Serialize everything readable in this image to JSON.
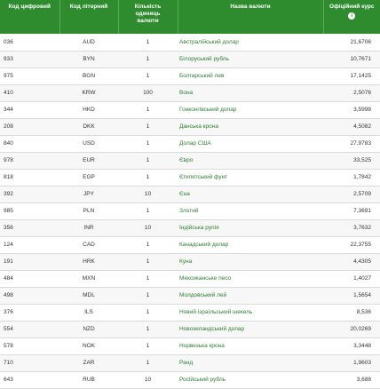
{
  "header": {
    "numeric_code": "Код цифровий",
    "letter_code": "Код літерний",
    "units_line1": "Кількість",
    "units_line2": "одиниць",
    "units_line3": "валюти",
    "name": "Назва валюти",
    "rate": "Офіційний курс",
    "info_icon": "i"
  },
  "colors": {
    "header_bg": "#2e8b2e",
    "name_link": "#2e7d32"
  },
  "rows": [
    {
      "code": "036",
      "alpha": "AUD",
      "units": "1",
      "name": "Австралійський долар",
      "rate": "21,6706"
    },
    {
      "code": "933",
      "alpha": "BYN",
      "units": "1",
      "name": "Білоруський рубль",
      "rate": "10,7671"
    },
    {
      "code": "975",
      "alpha": "BGN",
      "units": "1",
      "name": "Болгарський лев",
      "rate": "17,1425"
    },
    {
      "code": "410",
      "alpha": "KRW",
      "units": "100",
      "name": "Вона",
      "rate": "2,5076"
    },
    {
      "code": "344",
      "alpha": "HKD",
      "units": "1",
      "name": "Гонконгівський долар",
      "rate": "3,5998"
    },
    {
      "code": "208",
      "alpha": "DKK",
      "units": "1",
      "name": "Данська крона",
      "rate": "4,5082"
    },
    {
      "code": "840",
      "alpha": "USD",
      "units": "1",
      "name": "Долар США",
      "rate": "27,9783"
    },
    {
      "code": "978",
      "alpha": "EUR",
      "units": "1",
      "name": "Євро",
      "rate": "33,525"
    },
    {
      "code": "818",
      "alpha": "EGP",
      "units": "1",
      "name": "Єгипетський фунт",
      "rate": "1,7842"
    },
    {
      "code": "392",
      "alpha": "JPY",
      "units": "10",
      "name": "Єна",
      "rate": "2,5709"
    },
    {
      "code": "985",
      "alpha": "PLN",
      "units": "1",
      "name": "Злотий",
      "rate": "7,3691"
    },
    {
      "code": "356",
      "alpha": "INR",
      "units": "10",
      "name": "Індійська рупія",
      "rate": "3,7632"
    },
    {
      "code": "124",
      "alpha": "CAD",
      "units": "1",
      "name": "Канадський долар",
      "rate": "22,3755"
    },
    {
      "code": "191",
      "alpha": "HRK",
      "units": "1",
      "name": "Куна",
      "rate": "4,4305"
    },
    {
      "code": "484",
      "alpha": "MXN",
      "units": "1",
      "name": "Мексиканське песо",
      "rate": "1,4027"
    },
    {
      "code": "498",
      "alpha": "MDL",
      "units": "1",
      "name": "Молдовський лей",
      "rate": "1,5654"
    },
    {
      "code": "376",
      "alpha": "ILS",
      "units": "1",
      "name": "Новий ізраїльський шекель",
      "rate": "8,536"
    },
    {
      "code": "554",
      "alpha": "NZD",
      "units": "1",
      "name": "Новозеландський долар",
      "rate": "20,0269"
    },
    {
      "code": "578",
      "alpha": "NOK",
      "units": "1",
      "name": "Норвезька крона",
      "rate": "3,3448"
    },
    {
      "code": "710",
      "alpha": "ZAR",
      "units": "1",
      "name": "Ранд",
      "rate": "1,9603"
    },
    {
      "code": "643",
      "alpha": "RUB",
      "units": "10",
      "name": "Російський рубль",
      "rate": "3,688"
    }
  ]
}
